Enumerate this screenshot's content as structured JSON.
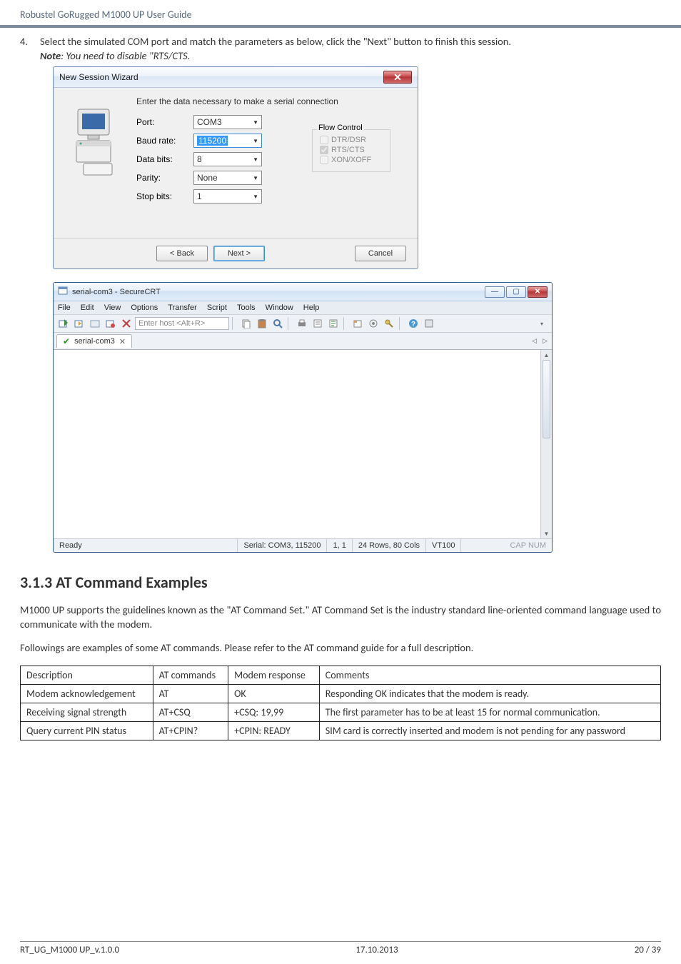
{
  "header": {
    "title": "Robustel GoRugged M1000 UP User Guide"
  },
  "step": {
    "num": "4.",
    "text_a": "Select the simulated COM port and match the parameters as below, click the \"Next\" button to finish this session.",
    "note_strong": "Note",
    "note_rest": ": You need to disable \"RTS/CTS."
  },
  "wizard": {
    "title": "New Session Wizard",
    "desc": "Enter the data necessary to make a serial connection",
    "fields": {
      "port_label": "Port:",
      "port_value": "COM3",
      "baud_label": "Baud rate:",
      "baud_value": "115200",
      "data_label": "Data bits:",
      "data_value": "8",
      "parity_label": "Parity:",
      "parity_value": "None",
      "stop_label": "Stop bits:",
      "stop_value": "1"
    },
    "flow": {
      "title": "Flow Control",
      "dtr": "DTR/DSR",
      "rts": "RTS/CTS",
      "xon": "XON/XOFF"
    },
    "buttons": {
      "back": "< Back",
      "next": "Next >",
      "cancel": "Cancel"
    }
  },
  "scrt": {
    "title": "serial-com3 - SecureCRT",
    "menu": [
      "File",
      "Edit",
      "View",
      "Options",
      "Transfer",
      "Script",
      "Tools",
      "Window",
      "Help"
    ],
    "host_placeholder": "Enter host <Alt+R>",
    "tab_label": "serial-com3",
    "status": {
      "ready": "Ready",
      "serial": "Serial: COM3, 115200",
      "pos": "1,  1",
      "size": "24 Rows, 80 Cols",
      "term": "VT100",
      "cap": "CAP  NUM"
    }
  },
  "section_heading": "3.1.3  AT Command Examples",
  "para1": "M1000 UP supports the guidelines known as the \"AT Command Set.\" AT Command Set is the industry standard line-oriented command language used to communicate with the modem.",
  "para2": "Followings are examples of some AT commands. Please refer to the AT command guide for a full description.",
  "table": {
    "headers": [
      "Description",
      "AT commands",
      "Modem response",
      "Comments"
    ],
    "rows": [
      {
        "desc": "Modem acknowledgement",
        "cmd": "AT",
        "resp": "OK",
        "comment": "Responding OK indicates that the modem is ready."
      },
      {
        "desc": "Receiving signal strength",
        "cmd": "AT+CSQ",
        "resp": "+CSQ: 19,99",
        "comment": "The first parameter has to be at least 15 for normal communication."
      },
      {
        "desc": "Query current PIN status",
        "cmd": "AT+CPIN?",
        "resp": "+CPIN: READY",
        "comment": "SIM card is correctly inserted and modem is not pending for any password"
      }
    ]
  },
  "footer": {
    "left": "RT_UG_M1000 UP_v.1.0.0",
    "center": "17.10.2013",
    "right": "20 / 39"
  }
}
